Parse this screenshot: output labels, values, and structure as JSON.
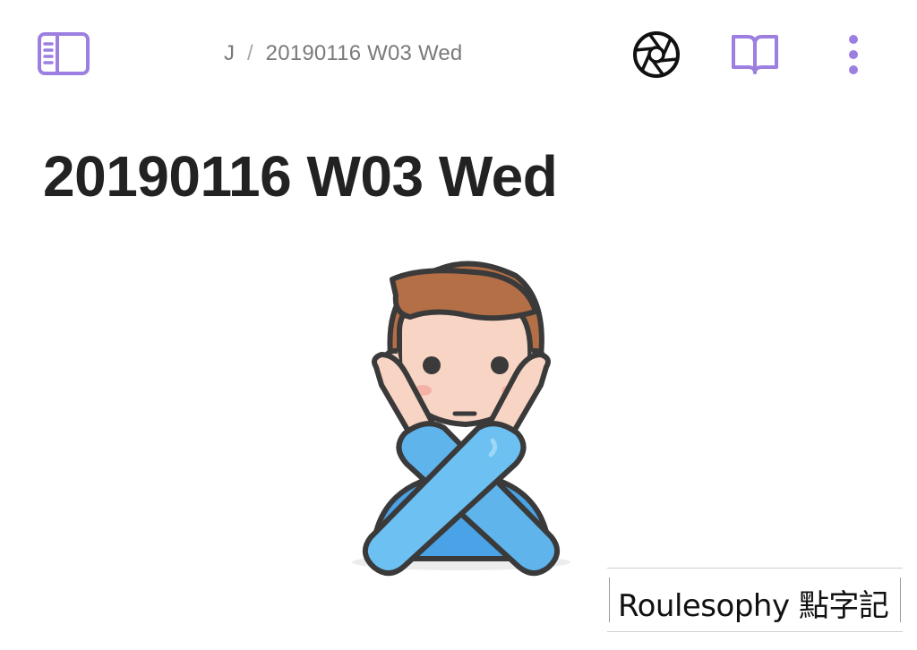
{
  "header": {
    "breadcrumb": {
      "parent": "J",
      "separator": "/",
      "current": "20190116 W03 Wed"
    },
    "icons": {
      "sidebar": "sidebar-toggle-icon",
      "lens": "camera-aperture-icon",
      "book": "book-icon",
      "more": "more-vertical-icon"
    }
  },
  "page": {
    "title": "20190116 W03 Wed",
    "illustration": "man-gesturing-no-emoji"
  },
  "watermark": {
    "text": "Roulesophy 點字記"
  },
  "colors": {
    "accent": "#9c7fe0",
    "text": "#222222",
    "muted": "#7a7a7a",
    "skin": "#f7d4c4",
    "hair": "#b56f47",
    "sleeve": "#5fb4ec",
    "outline": "#3a3a3a"
  }
}
